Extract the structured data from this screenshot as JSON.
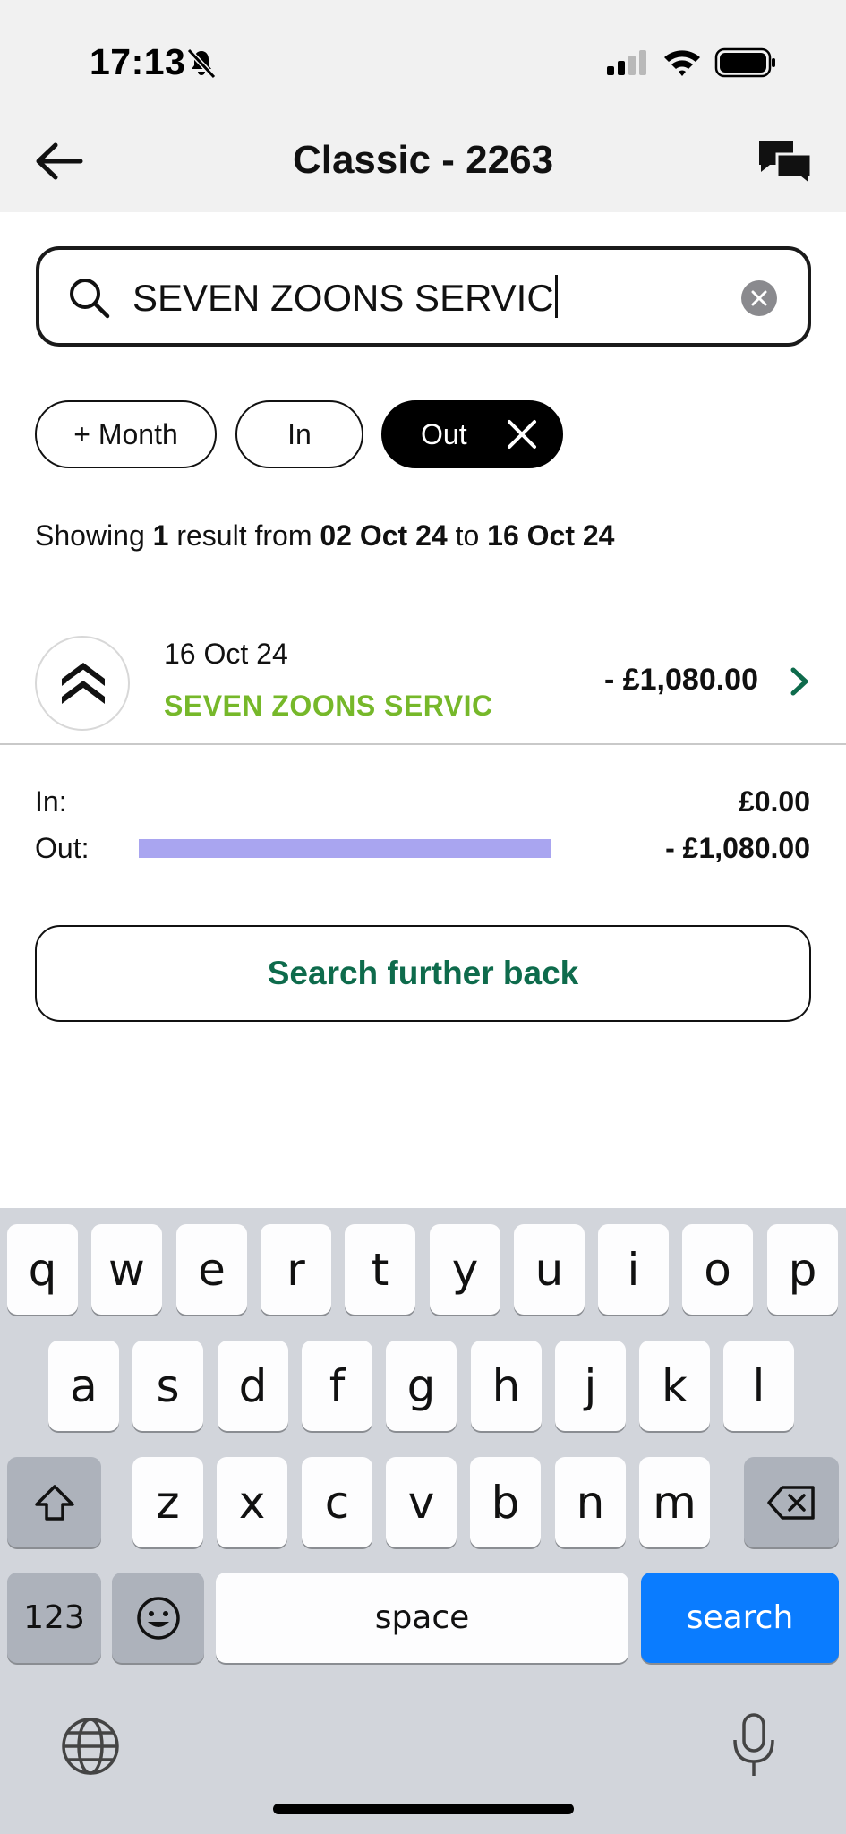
{
  "status_bar": {
    "time": "17:13"
  },
  "header": {
    "title": "Classic - 2263"
  },
  "search": {
    "value": "SEVEN ZOONS SERVIC"
  },
  "filters": {
    "month": "+ Month",
    "in": "In",
    "out": "Out"
  },
  "summary": {
    "prefix": "Showing ",
    "count": "1",
    "mid": " result from ",
    "from": "02 Oct 24",
    "to_word": " to ",
    "to": "16 Oct 24"
  },
  "transaction": {
    "date": "16 Oct 24",
    "name": "SEVEN ZOONS SERVIC",
    "amount": "- £1,080.00"
  },
  "totals": {
    "in_label": "In:",
    "in_value": "£0.00",
    "out_label": "Out:",
    "out_value": "- £1,080.00",
    "out_bar_fraction": 1.0
  },
  "search_further_label": "Search further back",
  "keyboard": {
    "row1": [
      "q",
      "w",
      "e",
      "r",
      "t",
      "y",
      "u",
      "i",
      "o",
      "p"
    ],
    "row2": [
      "a",
      "s",
      "d",
      "f",
      "g",
      "h",
      "j",
      "k",
      "l"
    ],
    "row3": [
      "z",
      "x",
      "c",
      "v",
      "b",
      "n",
      "m"
    ],
    "numbers_label": "123",
    "space_label": "space",
    "search_label": "search"
  },
  "colors": {
    "accent_green": "#0e6b4c",
    "merchant_green": "#76b82a",
    "bar": "#a9a5f0",
    "key_blue": "#0a7cff"
  }
}
